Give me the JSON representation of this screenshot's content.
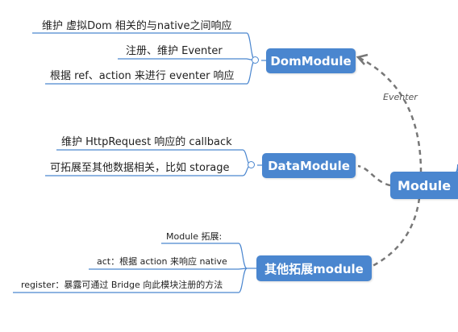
{
  "colors": {
    "node": "#4a86cf",
    "line": "#4a86cf",
    "dash": "#777777"
  },
  "root": {
    "label": "Module"
  },
  "edge_label": "Eventer",
  "branches": [
    {
      "label": "DomModule",
      "leaves": [
        "维护 虚拟Dom 相关的与native之间响应",
        "注册、维护 Eventer",
        "根据 ref、action 来进行 eventer 响应"
      ]
    },
    {
      "label": "DataModule",
      "leaves": [
        "维护 HttpRequest 响应的 callback",
        "可拓展至其他数据相关，比如 storage"
      ]
    },
    {
      "label": "其他拓展module",
      "leaves": [
        "Module 拓展:",
        "act：根据 action 来响应 native",
        "register：暴露可通过 Bridge 向此模块注册的方法"
      ]
    }
  ]
}
